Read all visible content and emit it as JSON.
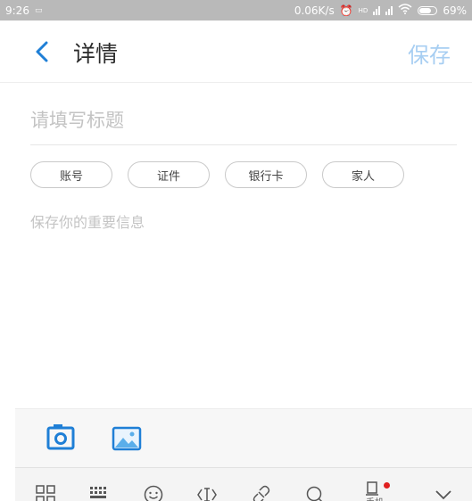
{
  "status_bar": {
    "time": "9:26",
    "net_speed": "0.06K/s",
    "network_type": "HD",
    "battery": "69%"
  },
  "header": {
    "back_icon": "chevron-left-icon",
    "title": "详情",
    "save_label": "保存"
  },
  "title_field": {
    "placeholder": "请填写标题",
    "value": ""
  },
  "tags": [
    {
      "label": "账号"
    },
    {
      "label": "证件"
    },
    {
      "label": "银行卡"
    },
    {
      "label": "家人"
    }
  ],
  "body_field": {
    "placeholder": "保存你的重要信息",
    "value": ""
  },
  "attachment_bar": {
    "icons": [
      "camera-icon",
      "image-icon"
    ]
  },
  "keyboard_toolbar": {
    "icons": [
      "grid-icon",
      "keyboard-icon",
      "emoji-icon",
      "cursor-icon",
      "link-icon",
      "search-icon",
      "phone-icon",
      "collapse-icon"
    ],
    "phone_label": "手机"
  },
  "colors": {
    "accent": "#1f7fd6",
    "save_disabled": "#a7cef2",
    "notification_dot": "#e02020"
  }
}
